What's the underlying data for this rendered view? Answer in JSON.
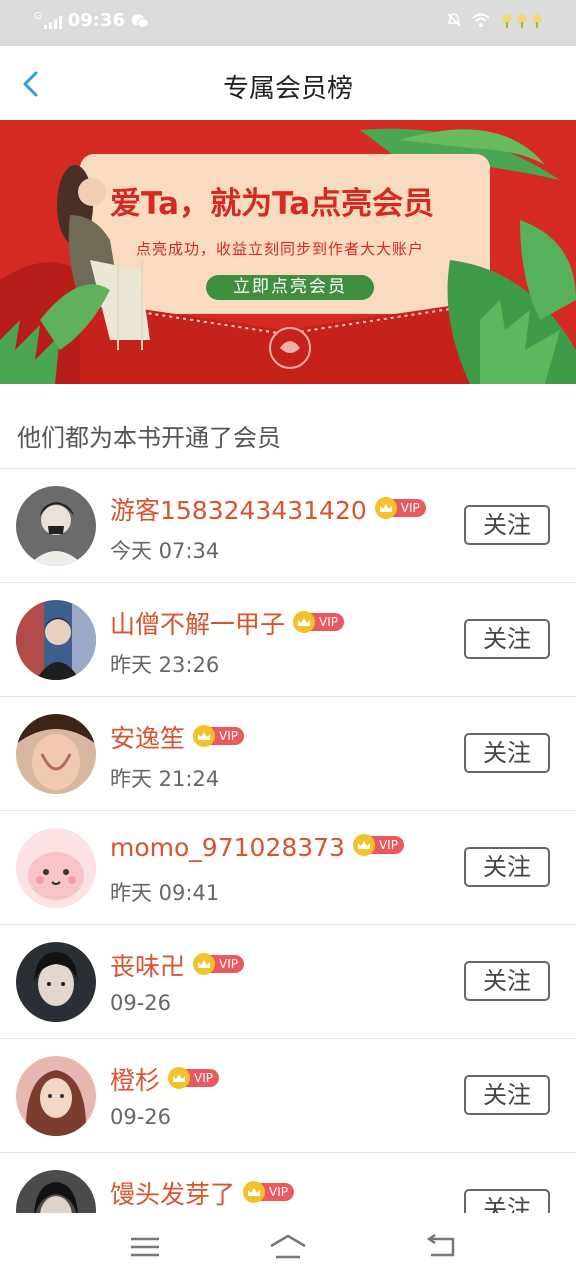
{
  "status_bar": {
    "signal_label": "G",
    "time": "09:36"
  },
  "header": {
    "title": "专属会员榜"
  },
  "banner": {
    "headline": "爱Ta，就为Ta点亮会员",
    "subline": "点亮成功，收益立刻同步到作者大大账户",
    "cta_label": "立即点亮会员"
  },
  "section": {
    "title": "他们都为本书开通了会员"
  },
  "vip_label": "VIP",
  "follow_label": "关注",
  "members": [
    {
      "name": "游客1583243431420",
      "time": "今天 07:34"
    },
    {
      "name": "山僧不解一甲子",
      "time": "昨天 23:26"
    },
    {
      "name": "安逸笙",
      "time": "昨天 21:24"
    },
    {
      "name": "momo_971028373",
      "time": "昨天 09:41"
    },
    {
      "name": "丧味卍",
      "time": "09-26"
    },
    {
      "name": "橙杉",
      "time": "09-26"
    },
    {
      "name": "馒头发芽了",
      "time": ""
    }
  ],
  "colors": {
    "accent": "#d9542d",
    "banner_red": "#d42a22",
    "vip_tag": "#e9595f",
    "crown": "#f3c12a"
  }
}
